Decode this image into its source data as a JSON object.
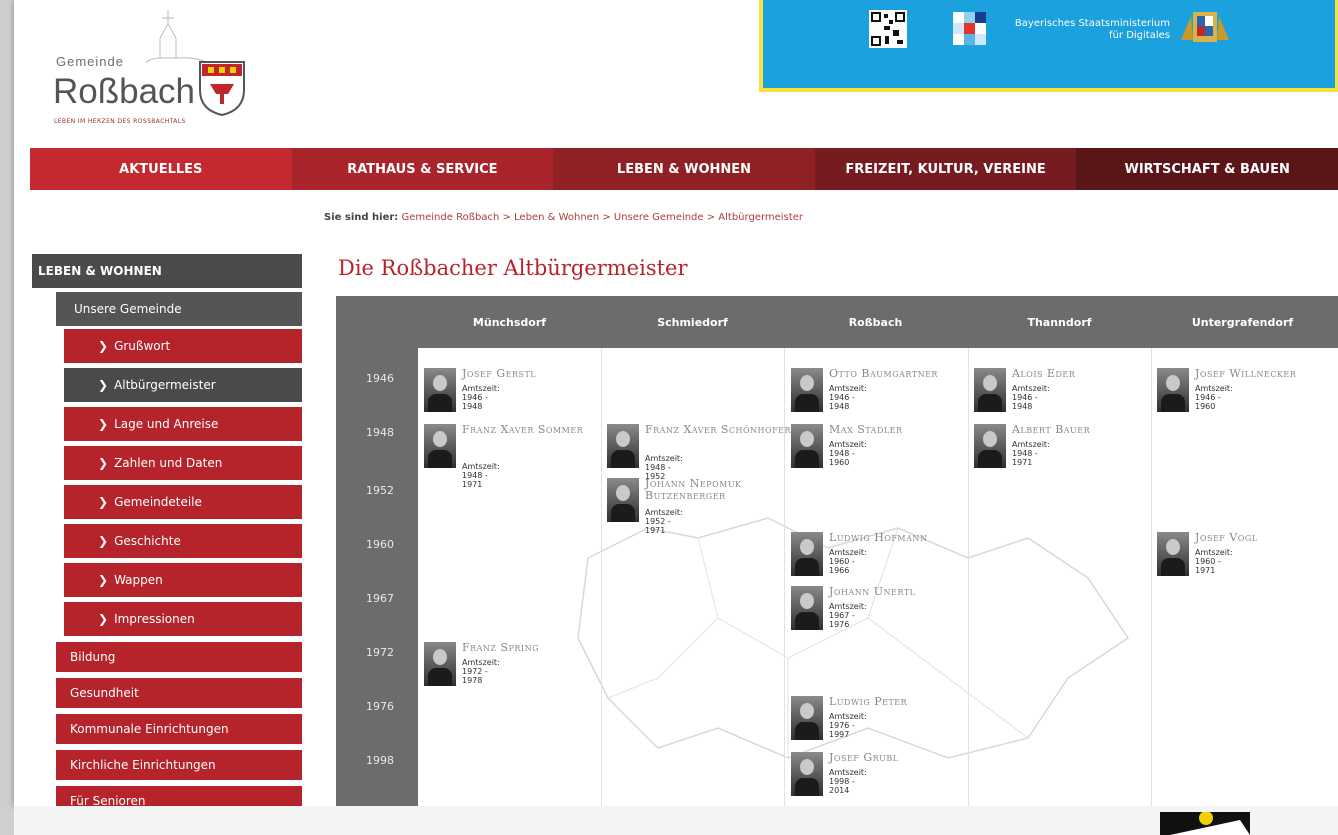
{
  "header": {
    "logo_gemeinde": "Gemeinde",
    "logo_name": "Roßbach",
    "logo_tagline": "LEBEN IM HERZEN DES ROSSBACHTALS",
    "ministry_line1": "Bayerisches Staatsministerium",
    "ministry_line2": "für Digitales"
  },
  "nav": [
    "AKTUELLES",
    "RATHAUS & SERVICE",
    "LEBEN & WOHNEN",
    "FREIZEIT, KULTUR, VEREINE",
    "WIRTSCHAFT & BAUEN"
  ],
  "breadcrumb": {
    "prefix": "Sie sind hier:",
    "path": "Gemeinde Roßbach > Leben & Wohnen > Unsere Gemeinde > Altbürgermeister"
  },
  "sidebar": {
    "heading": "LEBEN & WOHNEN",
    "sub": "Unsere Gemeinde",
    "items": [
      "Grußwort",
      "Altbürgermeister",
      "Lage und Anreise",
      "Zahlen und Daten",
      "Gemeindeteile",
      "Geschichte",
      "Wappen",
      "Impressionen"
    ],
    "sections": [
      "Bildung",
      "Gesundheit",
      "Kommunale Einrichtungen",
      "Kirchliche Einrichtungen",
      "Für Senioren"
    ]
  },
  "page_title": "Die Roßbacher Altbürgermeister",
  "columns": [
    "Münchsdorf",
    "Schmiedorf",
    "Roßbach",
    "Thanndorf",
    "Untergrafendorf"
  ],
  "years": [
    "1946",
    "1948",
    "1952",
    "1960",
    "1967",
    "1972",
    "1976",
    "1998"
  ],
  "mayors": {
    "gerstl": {
      "name": "Josef Gerstl",
      "term": "Amtszeit: 1946 - 1948"
    },
    "sommer": {
      "name": "Franz Xaver Sommer",
      "term": "Amtszeit: 1948 - 1971"
    },
    "spring": {
      "name": "Franz Spring",
      "term": "Amtszeit: 1972 - 1978"
    },
    "schoenhofer": {
      "name": "Franz Xaver Schönhofer",
      "term": "Amtszeit: 1948 - 1952"
    },
    "butzenberger": {
      "name": "Johann Nepomuk Butzenberger",
      "term": "Amtszeit: 1952 - 1971"
    },
    "baumgartner": {
      "name": "Otto Baumgartner",
      "term": "Amtszeit: 1946 - 1948"
    },
    "stadler": {
      "name": "Max Stadler",
      "term": "Amtszeit: 1948 - 1960"
    },
    "hofmann": {
      "name": "Ludwig Hofmann",
      "term": "Amtszeit: 1960 - 1966"
    },
    "unertl": {
      "name": "Johann Unertl",
      "term": "Amtszeit: 1967 - 1976"
    },
    "peter": {
      "name": "Ludwig Peter",
      "term": "Amtszeit: 1976 - 1997"
    },
    "grubl": {
      "name": "Josef Grubl",
      "term": "Amtszeit: 1998 - 2014"
    },
    "eder": {
      "name": "Alois Eder",
      "term": "Amtszeit: 1946 - 1948"
    },
    "bauer": {
      "name": "Albert Bauer",
      "term": "Amtszeit: 1948 - 1971"
    },
    "willnecker": {
      "name": "Josef Willnecker",
      "term": "Amtszeit: 1946 - 1960"
    },
    "vogl": {
      "name": "Josef Vogl",
      "term": "Amtszeit: 1960 - 1971"
    }
  }
}
